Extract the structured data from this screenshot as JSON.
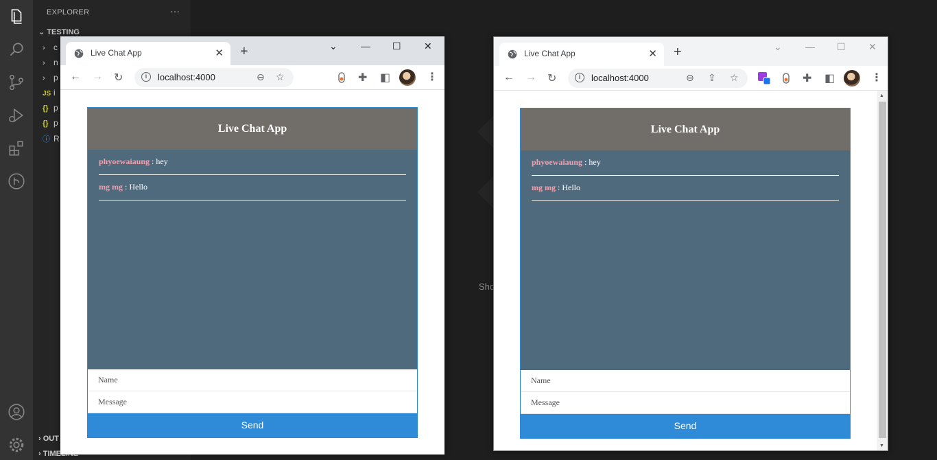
{
  "vscode": {
    "explorer_title": "EXPLORER",
    "explorer_more": "···",
    "section": "TESTING",
    "tree": [
      {
        "glyph": "›",
        "label": "c"
      },
      {
        "glyph": "›",
        "label": "n"
      },
      {
        "glyph": "›",
        "label": "p"
      },
      {
        "glyph": "JS",
        "label": "i"
      },
      {
        "glyph": "{}",
        "label": "p"
      },
      {
        "glyph": "{}",
        "label": "p"
      },
      {
        "glyph": "ⓘ",
        "label": "R"
      }
    ],
    "outline": "OUT",
    "timeline": "TIMELINE",
    "editor_hint": "Sho"
  },
  "browser": {
    "tab_title": "Live Chat App",
    "url": "localhost:4000",
    "new_tab": "+",
    "close": "✕"
  },
  "chat": {
    "title": "Live Chat App",
    "messages": [
      {
        "name": "phyoewaiaung",
        "text": " : hey"
      },
      {
        "name": "mg mg",
        "text": " : Hello"
      }
    ],
    "name_placeholder": "Name",
    "message_placeholder": "Message",
    "send_label": "Send"
  },
  "colors": {
    "header": "#716d69",
    "body": "#506a7d",
    "name": "#f49eab",
    "send": "#2f8bd8"
  }
}
